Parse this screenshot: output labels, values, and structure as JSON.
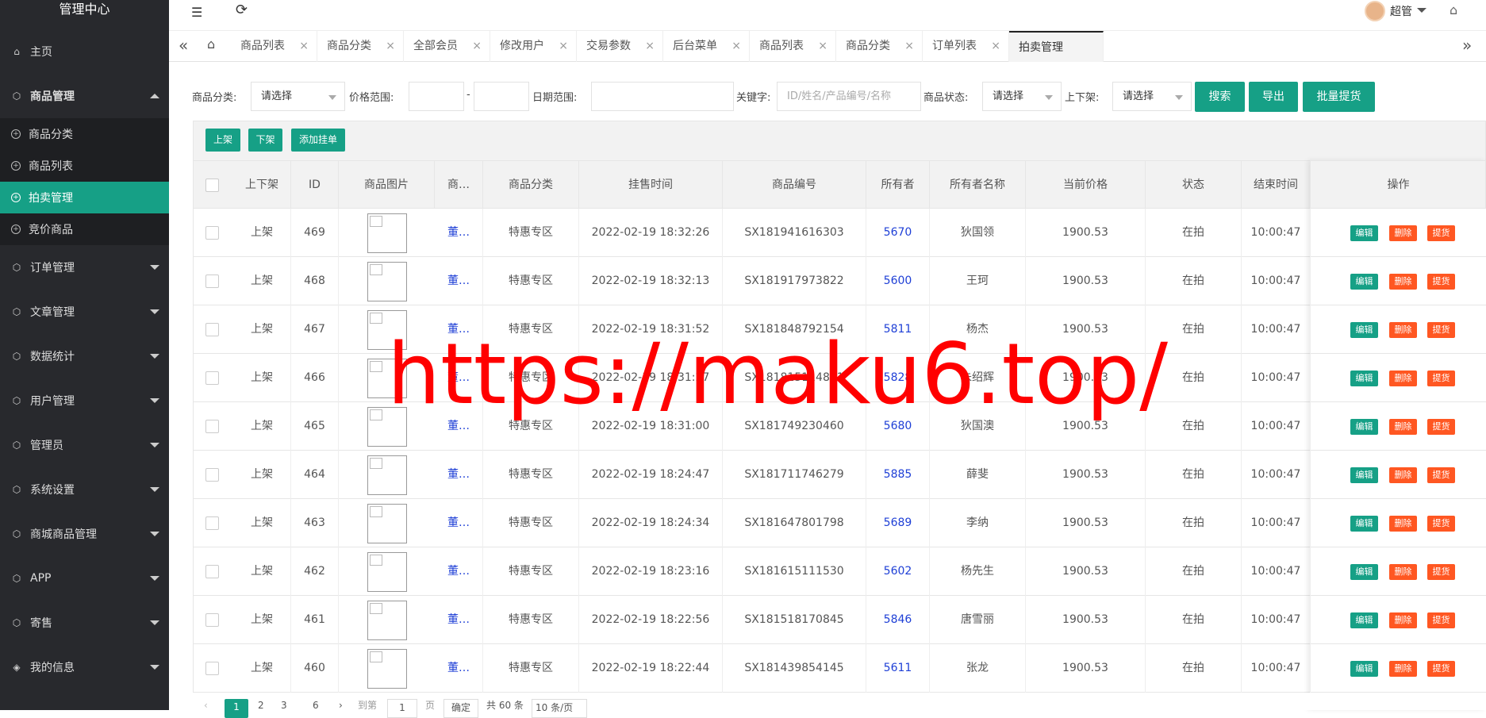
{
  "sidebar": {
    "title": "管理中心",
    "items": [
      {
        "label": "主页",
        "icon": "home-icon"
      },
      {
        "label": "商品管理",
        "icon": "cube-icon",
        "expanded": true,
        "children": [
          "商品分类",
          "商品列表",
          "拍卖管理",
          "竞价商品"
        ],
        "active_child": "拍卖管理"
      },
      {
        "label": "订单管理",
        "icon": "cube-icon"
      },
      {
        "label": "文章管理",
        "icon": "cube-icon"
      },
      {
        "label": "数据统计",
        "icon": "cube-icon"
      },
      {
        "label": "用户管理",
        "icon": "cube-icon"
      },
      {
        "label": "管理员",
        "icon": "cube-icon"
      },
      {
        "label": "系统设置",
        "icon": "cube-icon"
      },
      {
        "label": "商城商品管理",
        "icon": "cube-icon"
      },
      {
        "label": "APP",
        "icon": "cube-icon"
      },
      {
        "label": "寄售",
        "icon": "cube-icon"
      },
      {
        "label": "我的信息",
        "icon": "shield-icon"
      }
    ]
  },
  "topbar": {
    "user": "超管",
    "icons": [
      "menu-toggle-icon",
      "refresh-icon",
      "avatar",
      "tag-icon"
    ]
  },
  "tabs": [
    "商品列表",
    "商品分类",
    "全部会员",
    "修改用户",
    "交易参数",
    "后台菜单",
    "商品列表",
    "商品分类",
    "订单列表",
    "拍卖管理"
  ],
  "active_tab": "拍卖管理",
  "filters": {
    "category_label": "商品分类:",
    "category_value": "请选择",
    "price_label": "价格范围:",
    "price_sep": "-",
    "date_label": "日期范围:",
    "keyword_label": "关键字:",
    "keyword_placeholder": "ID/姓名/产品编号/名称",
    "status_label": "商品状态:",
    "status_value": "请选择",
    "shelf_label": "上下架:",
    "shelf_value": "请选择",
    "search_btn": "搜索",
    "export_btn": "导出",
    "batch_btn": "批量提货"
  },
  "toolbar": {
    "up": "上架",
    "down": "下架",
    "add": "添加挂单"
  },
  "table": {
    "headers": [
      "上下架",
      "ID",
      "商品图片",
      "商…",
      "商品分类",
      "挂售时间",
      "商品编号",
      "所有者",
      "所有者名称",
      "当前价格",
      "状态",
      "结束时间",
      "操作"
    ],
    "rows": [
      {
        "shelf": "上架",
        "id": "469",
        "name": "董…",
        "cat": "特惠专区",
        "time": "2022-02-19 18:32:26",
        "code": "SX181941616303",
        "owner": "5670",
        "owner_name": "狄国领",
        "price": "1900.53",
        "status": "在拍",
        "end": "10:00:47"
      },
      {
        "shelf": "上架",
        "id": "468",
        "name": "董…",
        "cat": "特惠专区",
        "time": "2022-02-19 18:32:13",
        "code": "SX181917973822",
        "owner": "5600",
        "owner_name": "王珂",
        "price": "1900.53",
        "status": "在拍",
        "end": "10:00:47"
      },
      {
        "shelf": "上架",
        "id": "467",
        "name": "董…",
        "cat": "特惠专区",
        "time": "2022-02-19 18:31:52",
        "code": "SX181848792154",
        "owner": "5811",
        "owner_name": "杨杰",
        "price": "1900.53",
        "status": "在拍",
        "end": "10:00:47"
      },
      {
        "shelf": "上架",
        "id": "466",
        "name": "董…",
        "cat": "特惠专区",
        "time": "2022-02-19 18:31:27",
        "code": "SX181815114831",
        "owner": "5828",
        "owner_name": "朱绍辉",
        "price": "1900.53",
        "status": "在拍",
        "end": "10:00:47"
      },
      {
        "shelf": "上架",
        "id": "465",
        "name": "董…",
        "cat": "特惠专区",
        "time": "2022-02-19 18:31:00",
        "code": "SX181749230460",
        "owner": "5680",
        "owner_name": "狄国澳",
        "price": "1900.53",
        "status": "在拍",
        "end": "10:00:47"
      },
      {
        "shelf": "上架",
        "id": "464",
        "name": "董…",
        "cat": "特惠专区",
        "time": "2022-02-19 18:24:47",
        "code": "SX181711746279",
        "owner": "5885",
        "owner_name": "薛斐",
        "price": "1900.53",
        "status": "在拍",
        "end": "10:00:47"
      },
      {
        "shelf": "上架",
        "id": "463",
        "name": "董…",
        "cat": "特惠专区",
        "time": "2022-02-19 18:24:34",
        "code": "SX181647801798",
        "owner": "5689",
        "owner_name": "李纳",
        "price": "1900.53",
        "status": "在拍",
        "end": "10:00:47"
      },
      {
        "shelf": "上架",
        "id": "462",
        "name": "董…",
        "cat": "特惠专区",
        "time": "2022-02-19 18:23:16",
        "code": "SX181615111530",
        "owner": "5602",
        "owner_name": "杨先生",
        "price": "1900.53",
        "status": "在拍",
        "end": "10:00:47"
      },
      {
        "shelf": "上架",
        "id": "461",
        "name": "董…",
        "cat": "特惠专区",
        "time": "2022-02-19 18:22:56",
        "code": "SX181518170845",
        "owner": "5846",
        "owner_name": "唐雪丽",
        "price": "1900.53",
        "status": "在拍",
        "end": "10:00:47"
      },
      {
        "shelf": "上架",
        "id": "460",
        "name": "董…",
        "cat": "特惠专区",
        "time": "2022-02-19 18:22:44",
        "code": "SX181439854145",
        "owner": "5611",
        "owner_name": "张龙",
        "price": "1900.53",
        "status": "在拍",
        "end": "10:00:47"
      }
    ],
    "ops": {
      "edit": "编辑",
      "delete": "删除",
      "pick": "提货"
    }
  },
  "pager": {
    "pages": [
      "1",
      "2",
      "3",
      "6"
    ],
    "current": "1",
    "goto_label": "到第",
    "goto_value": "1",
    "page_unit": "页",
    "confirm": "确定",
    "total": "共 60 条",
    "per_page": "10 条/页"
  },
  "watermark": "https://maku6.top/",
  "colors": {
    "sidebar_bg": "#28292d",
    "accent": "#16a086",
    "danger": "#ff5722",
    "link": "#1e3fd6",
    "watermark": "#ff0000"
  }
}
